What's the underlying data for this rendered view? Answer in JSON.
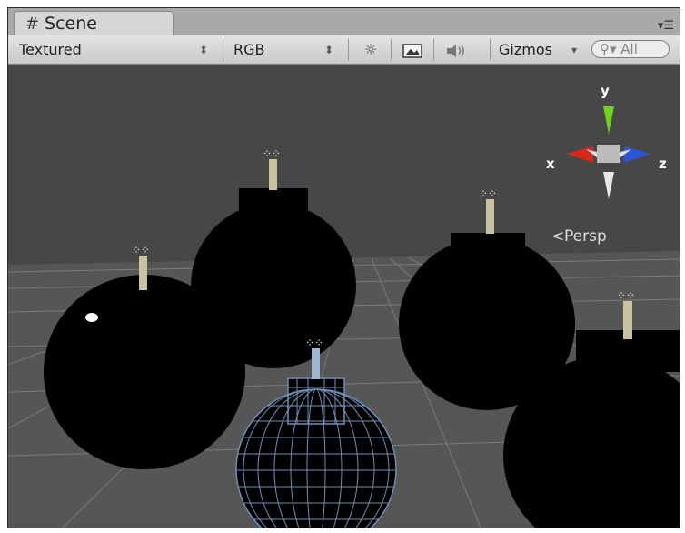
{
  "tab": {
    "icon": "hash-icon",
    "title": "Scene"
  },
  "toolbar": {
    "render_mode": "Textured",
    "color_mode": "RGB",
    "gizmos_label": "Gizmos",
    "search_placeholder": "All"
  },
  "gizmo": {
    "y_label": "y",
    "x_label": "x",
    "z_label": "z",
    "projection": "Persp"
  },
  "colors": {
    "sky": "#474747",
    "ground": "#5a5a5a",
    "axis_x": "#d8261a",
    "axis_y": "#6fd31d",
    "axis_z": "#2a55d8",
    "wire": "#6f8fb8"
  }
}
